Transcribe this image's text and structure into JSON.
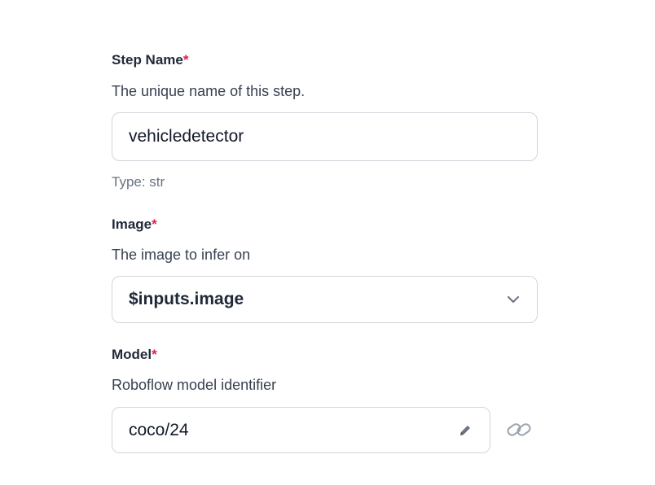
{
  "fields": {
    "step_name": {
      "label": "Step Name",
      "required_mark": "*",
      "description": "The unique name of this step.",
      "value": "vehicledetector",
      "type_hint": "Type: str"
    },
    "image": {
      "label": "Image",
      "required_mark": "*",
      "description": "The image to infer on",
      "selected_value": "$inputs.image",
      "control_icon": "chevron-down-icon"
    },
    "model": {
      "label": "Model",
      "required_mark": "*",
      "description": "Roboflow model identifier",
      "value": "coco/24",
      "edit_icon": "pencil-icon",
      "link_icon": "link-icon"
    }
  },
  "colors": {
    "required": "#e11d48",
    "label": "#1f2937",
    "description": "#374151",
    "type_hint": "#6b7280",
    "border": "#d1d5db",
    "icon": "#9ca3af"
  }
}
